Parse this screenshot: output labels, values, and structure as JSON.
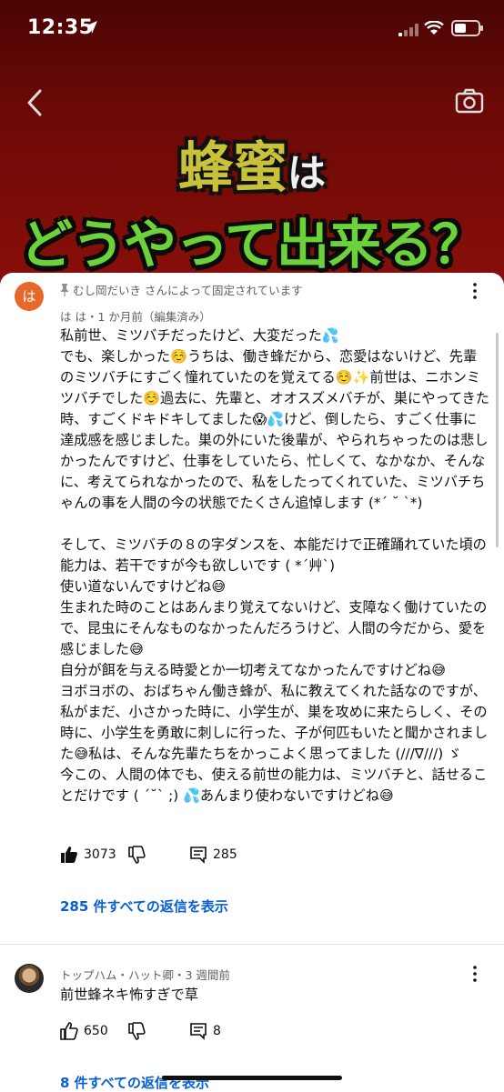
{
  "status_bar": {
    "time": "12:35"
  },
  "video": {
    "title_line1_main": "蜂蜜",
    "title_line1_small": "は",
    "title_line2": "どうやって出来る？"
  },
  "comment1": {
    "avatar_letter": "は",
    "pinned_text": "むし岡だいき さんによって固定されています",
    "author_line": "は は・1 か月前（編集済み）",
    "paragraphs": [
      "私前世、ミツバチだったけど、大変だった💦",
      "でも、楽しかった☺️うちは、働き蜂だから、恋愛はないけど、先輩のミツバチにすごく憧れていたのを覚えてる☺️✨前世は、ニホンミツバチでした☺️過去に、先輩と、オオスズメバチが、巣にやってきた時、すごくドキドキしてました😱💦けど、倒したら、すごく仕事に達成感を感じました。巣の外にいた後輩が、やられちゃったのは悲しかったんですけど、仕事をしていたら、忙しくて、なかなか、そんなに、考えてられなかったので、私をしたってくれていた、ミツバチちゃんの事を人間の今の状態でたくさん追悼します (*´ ˘ `*)",
      "",
      "そして、ミツバチの８の字ダンスを、本能だけで正確踊れていた頃の能力は、若干ですが今も欲しいです ( *´艸`)",
      "使い道ないんですけどね😅",
      "生まれた時のことはあんまり覚えてないけど、支障なく働けていたので、昆虫にそんなものなかったんだろうけど、人間の今だから、愛を感じました😅",
      "自分が餌を与える時愛とか一切考えてなかったんですけどね😅",
      "ヨボヨボの、おばちゃん働き蜂が、私に教えてくれた話なのですが、私がまだ、小さかった時に、小学生が、巣を攻めに来たらしく、その時に、小学生を勇敢に刺しに行った、子が何匹もいたと聞かされました😅私は、そんな先輩たちをかっこよく思ってました (///∇///) ゞ",
      "今この、人間の体でも、使える前世の能力は、ミツバチと、話せることだけです ( ´˘` ;) 💦あんまり使わないですけどね😅"
    ],
    "likes": "3073",
    "reply_count": "285",
    "view_replies": "285 件すべての返信を表示"
  },
  "comment2": {
    "author_line": "トップハム・ハット卿・3 週間前",
    "text": "前世蜂ネキ怖すぎで草",
    "likes": "650",
    "reply_count": "8",
    "view_replies": "8 件すべての返信を表示"
  }
}
